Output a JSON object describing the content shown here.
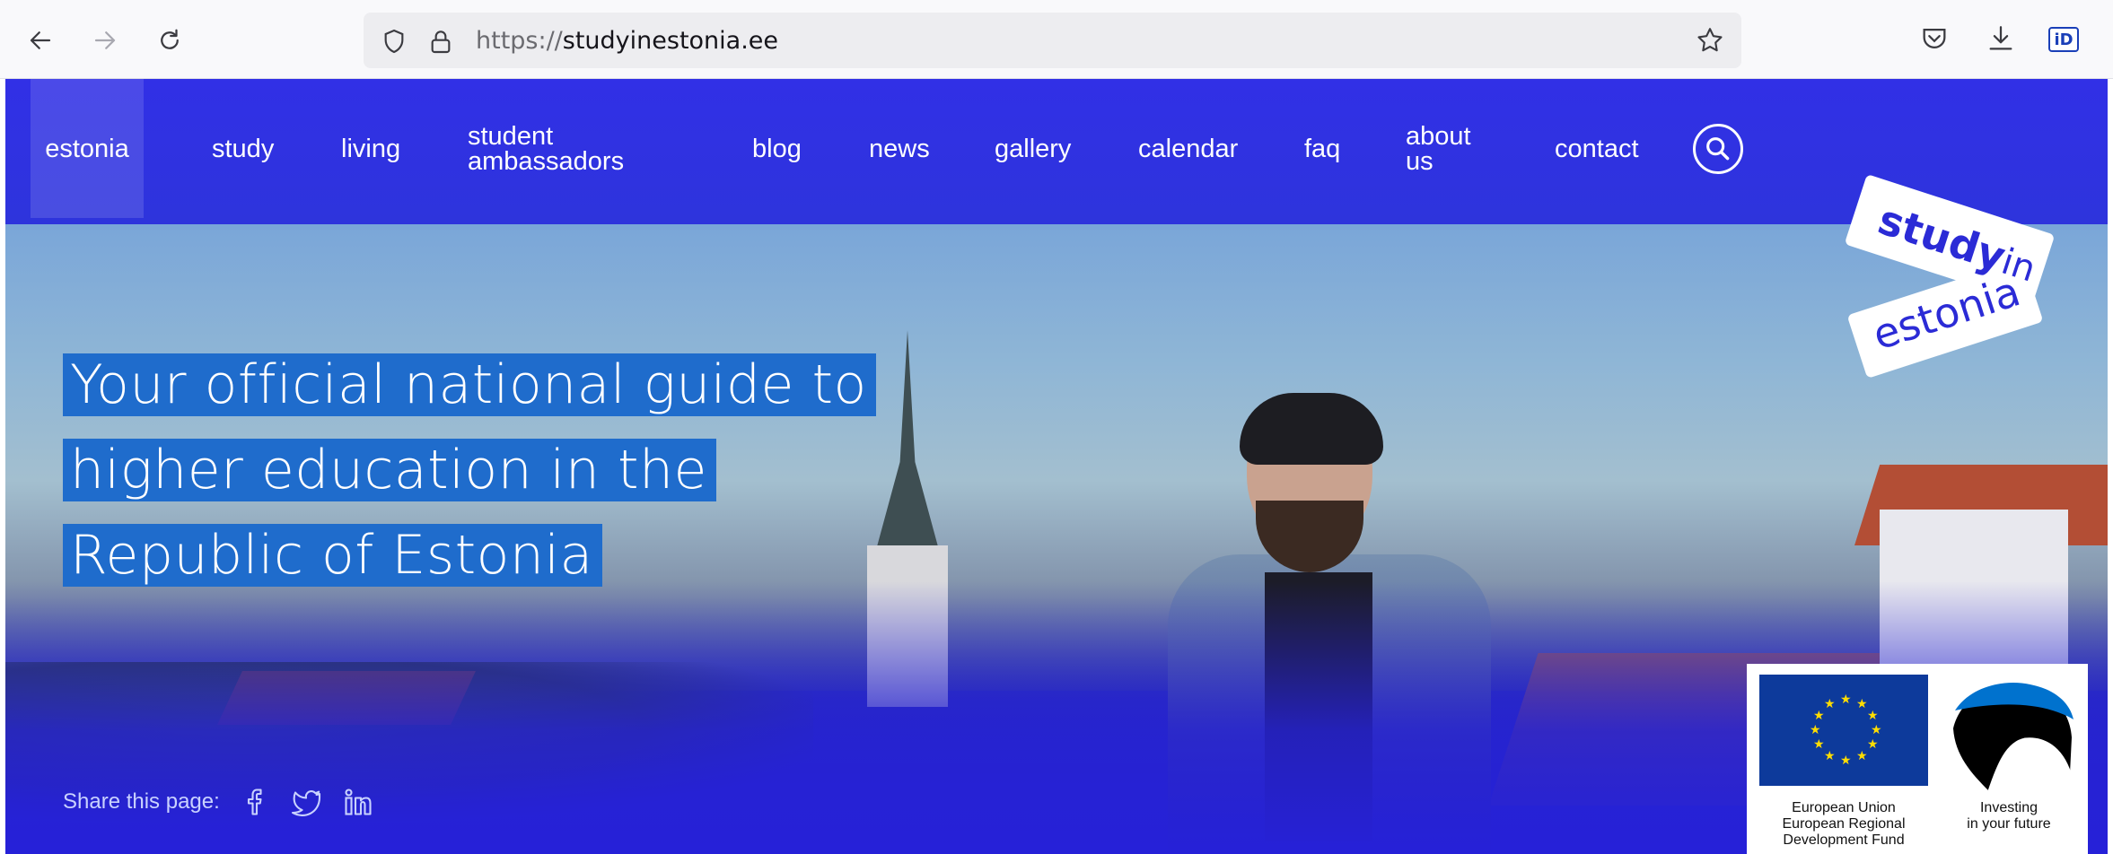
{
  "browser": {
    "url_prefix": "https://",
    "url_host": "studyinestonia.ee",
    "id_badge": "iD"
  },
  "nav": {
    "items": [
      {
        "label": "estonia"
      },
      {
        "label": "study"
      },
      {
        "label": "living"
      },
      {
        "label": "student ambassadors"
      },
      {
        "label": "blog"
      },
      {
        "label": "news"
      },
      {
        "label": "gallery"
      },
      {
        "label": "calendar"
      },
      {
        "label": "faq"
      },
      {
        "label": "about us"
      },
      {
        "label": "contact"
      }
    ]
  },
  "logo": {
    "line1": "study",
    "line1_small": "in",
    "line2": "estonia"
  },
  "hero": {
    "headline_lines": [
      "Your official national guide to",
      "higher education in the",
      "Republic of Estonia"
    ]
  },
  "share": {
    "label": "Share this page:",
    "icons": [
      "facebook-icon",
      "twitter-icon",
      "linkedin-icon"
    ]
  },
  "eu": {
    "eu_text": "European Union European Regional Development Fund",
    "eu_line1": "European Union",
    "eu_line2": "European Regional",
    "eu_line3": "Development Fund",
    "inv_line1": "Investing",
    "inv_line2": "in your future"
  },
  "colors": {
    "brand_blue": "#2e34dc",
    "headline_bg": "#1f6ccc"
  }
}
